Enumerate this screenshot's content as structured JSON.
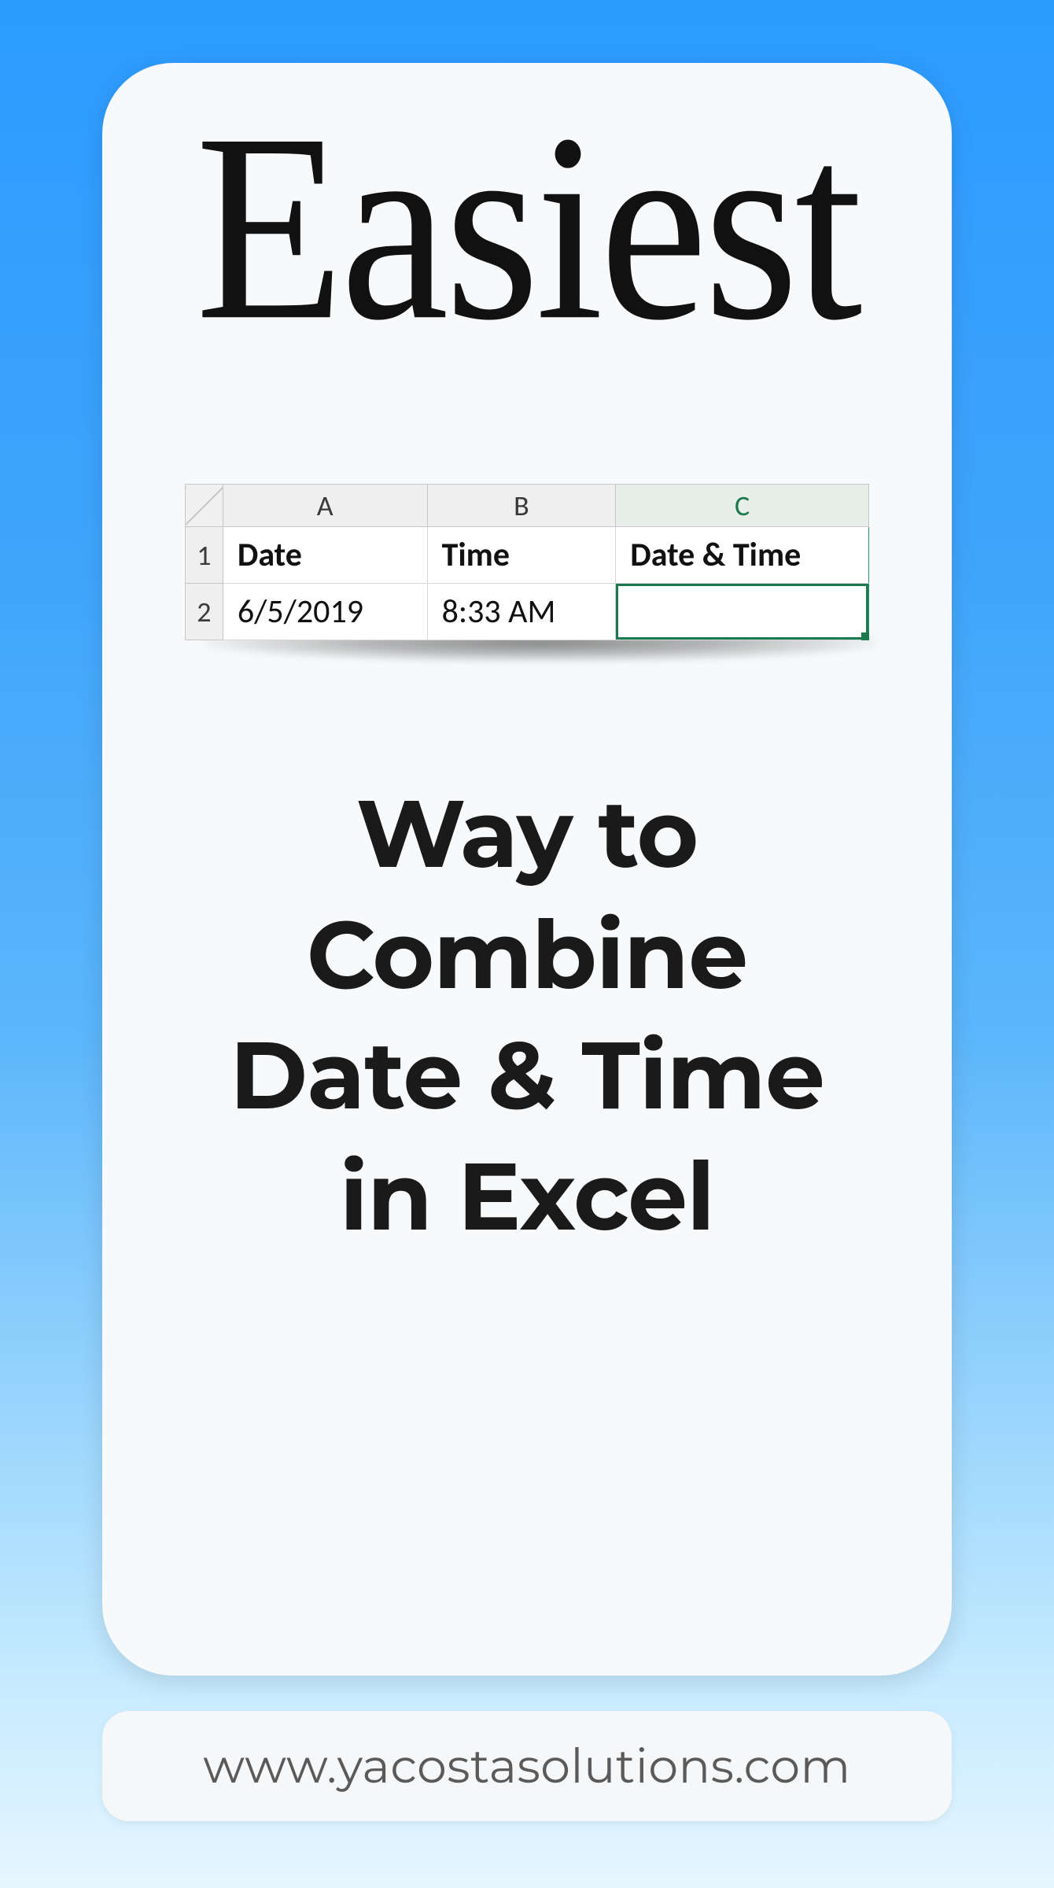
{
  "headline": "Easiest",
  "excel": {
    "columns": [
      "A",
      "B",
      "C"
    ],
    "rows": [
      {
        "num": "1",
        "cells": [
          "Date",
          "Time",
          "Date & Time"
        ]
      },
      {
        "num": "2",
        "cells": [
          "6/5/2019",
          "8:33 AM",
          ""
        ]
      }
    ],
    "selected": {
      "row": 2,
      "col": "C"
    }
  },
  "subhead_lines": [
    "Way to",
    "Combine",
    "Date & Time",
    "in Excel"
  ],
  "footer": "www.yacostasolutions.com"
}
